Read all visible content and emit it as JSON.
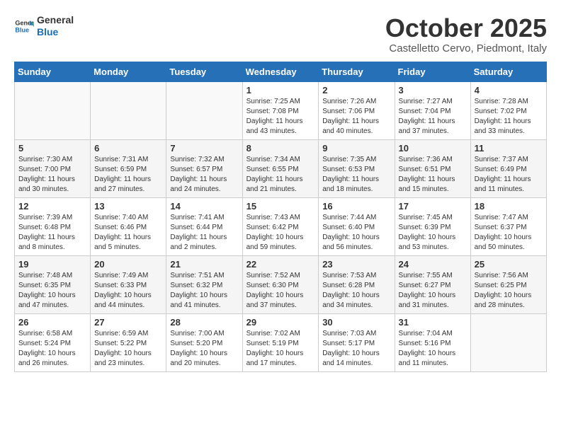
{
  "logo": {
    "line1": "General",
    "line2": "Blue"
  },
  "title": "October 2025",
  "location": "Castelletto Cervo, Piedmont, Italy",
  "headers": [
    "Sunday",
    "Monday",
    "Tuesday",
    "Wednesday",
    "Thursday",
    "Friday",
    "Saturday"
  ],
  "weeks": [
    [
      {
        "day": "",
        "info": ""
      },
      {
        "day": "",
        "info": ""
      },
      {
        "day": "",
        "info": ""
      },
      {
        "day": "1",
        "info": "Sunrise: 7:25 AM\nSunset: 7:08 PM\nDaylight: 11 hours\nand 43 minutes."
      },
      {
        "day": "2",
        "info": "Sunrise: 7:26 AM\nSunset: 7:06 PM\nDaylight: 11 hours\nand 40 minutes."
      },
      {
        "day": "3",
        "info": "Sunrise: 7:27 AM\nSunset: 7:04 PM\nDaylight: 11 hours\nand 37 minutes."
      },
      {
        "day": "4",
        "info": "Sunrise: 7:28 AM\nSunset: 7:02 PM\nDaylight: 11 hours\nand 33 minutes."
      }
    ],
    [
      {
        "day": "5",
        "info": "Sunrise: 7:30 AM\nSunset: 7:00 PM\nDaylight: 11 hours\nand 30 minutes."
      },
      {
        "day": "6",
        "info": "Sunrise: 7:31 AM\nSunset: 6:59 PM\nDaylight: 11 hours\nand 27 minutes."
      },
      {
        "day": "7",
        "info": "Sunrise: 7:32 AM\nSunset: 6:57 PM\nDaylight: 11 hours\nand 24 minutes."
      },
      {
        "day": "8",
        "info": "Sunrise: 7:34 AM\nSunset: 6:55 PM\nDaylight: 11 hours\nand 21 minutes."
      },
      {
        "day": "9",
        "info": "Sunrise: 7:35 AM\nSunset: 6:53 PM\nDaylight: 11 hours\nand 18 minutes."
      },
      {
        "day": "10",
        "info": "Sunrise: 7:36 AM\nSunset: 6:51 PM\nDaylight: 11 hours\nand 15 minutes."
      },
      {
        "day": "11",
        "info": "Sunrise: 7:37 AM\nSunset: 6:49 PM\nDaylight: 11 hours\nand 11 minutes."
      }
    ],
    [
      {
        "day": "12",
        "info": "Sunrise: 7:39 AM\nSunset: 6:48 PM\nDaylight: 11 hours\nand 8 minutes."
      },
      {
        "day": "13",
        "info": "Sunrise: 7:40 AM\nSunset: 6:46 PM\nDaylight: 11 hours\nand 5 minutes."
      },
      {
        "day": "14",
        "info": "Sunrise: 7:41 AM\nSunset: 6:44 PM\nDaylight: 11 hours\nand 2 minutes."
      },
      {
        "day": "15",
        "info": "Sunrise: 7:43 AM\nSunset: 6:42 PM\nDaylight: 10 hours\nand 59 minutes."
      },
      {
        "day": "16",
        "info": "Sunrise: 7:44 AM\nSunset: 6:40 PM\nDaylight: 10 hours\nand 56 minutes."
      },
      {
        "day": "17",
        "info": "Sunrise: 7:45 AM\nSunset: 6:39 PM\nDaylight: 10 hours\nand 53 minutes."
      },
      {
        "day": "18",
        "info": "Sunrise: 7:47 AM\nSunset: 6:37 PM\nDaylight: 10 hours\nand 50 minutes."
      }
    ],
    [
      {
        "day": "19",
        "info": "Sunrise: 7:48 AM\nSunset: 6:35 PM\nDaylight: 10 hours\nand 47 minutes."
      },
      {
        "day": "20",
        "info": "Sunrise: 7:49 AM\nSunset: 6:33 PM\nDaylight: 10 hours\nand 44 minutes."
      },
      {
        "day": "21",
        "info": "Sunrise: 7:51 AM\nSunset: 6:32 PM\nDaylight: 10 hours\nand 41 minutes."
      },
      {
        "day": "22",
        "info": "Sunrise: 7:52 AM\nSunset: 6:30 PM\nDaylight: 10 hours\nand 37 minutes."
      },
      {
        "day": "23",
        "info": "Sunrise: 7:53 AM\nSunset: 6:28 PM\nDaylight: 10 hours\nand 34 minutes."
      },
      {
        "day": "24",
        "info": "Sunrise: 7:55 AM\nSunset: 6:27 PM\nDaylight: 10 hours\nand 31 minutes."
      },
      {
        "day": "25",
        "info": "Sunrise: 7:56 AM\nSunset: 6:25 PM\nDaylight: 10 hours\nand 28 minutes."
      }
    ],
    [
      {
        "day": "26",
        "info": "Sunrise: 6:58 AM\nSunset: 5:24 PM\nDaylight: 10 hours\nand 26 minutes."
      },
      {
        "day": "27",
        "info": "Sunrise: 6:59 AM\nSunset: 5:22 PM\nDaylight: 10 hours\nand 23 minutes."
      },
      {
        "day": "28",
        "info": "Sunrise: 7:00 AM\nSunset: 5:20 PM\nDaylight: 10 hours\nand 20 minutes."
      },
      {
        "day": "29",
        "info": "Sunrise: 7:02 AM\nSunset: 5:19 PM\nDaylight: 10 hours\nand 17 minutes."
      },
      {
        "day": "30",
        "info": "Sunrise: 7:03 AM\nSunset: 5:17 PM\nDaylight: 10 hours\nand 14 minutes."
      },
      {
        "day": "31",
        "info": "Sunrise: 7:04 AM\nSunset: 5:16 PM\nDaylight: 10 hours\nand 11 minutes."
      },
      {
        "day": "",
        "info": ""
      }
    ]
  ]
}
